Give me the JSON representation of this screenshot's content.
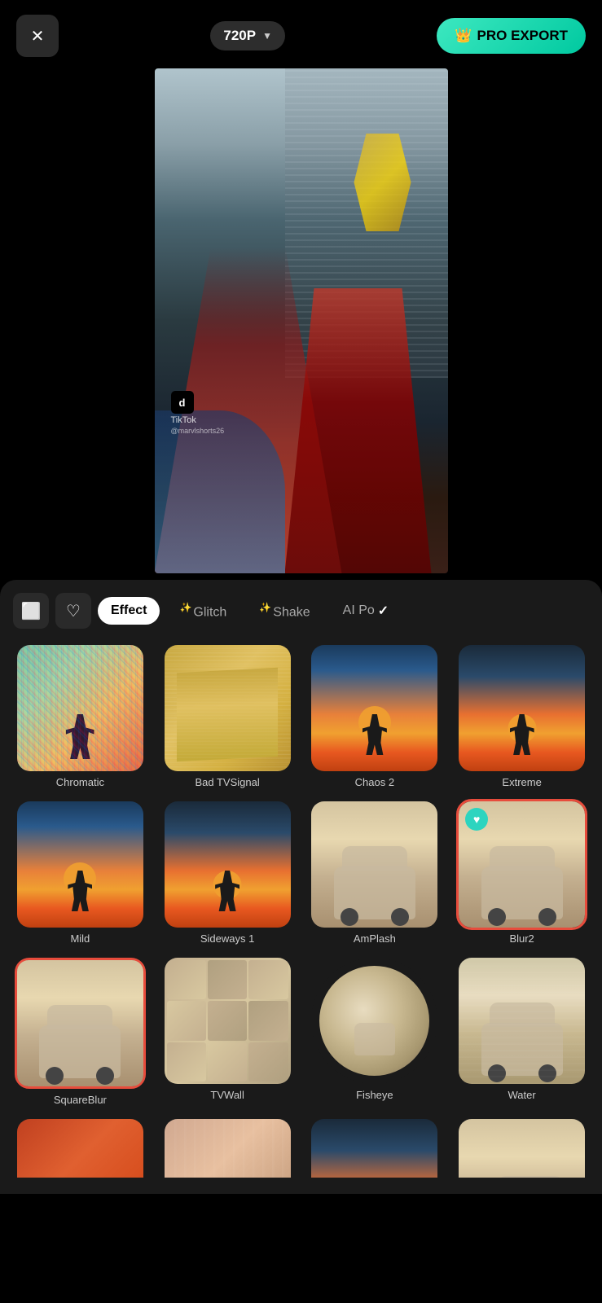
{
  "header": {
    "close_label": "✕",
    "quality": "720P",
    "quality_arrow": "▼",
    "pro_export_icon": "👑",
    "pro_export_label": "PRO EXPORT"
  },
  "video": {
    "watermark_logo": "d",
    "watermark_app": "TikTok",
    "watermark_user": "@marvlshorts26"
  },
  "tabs": [
    {
      "id": "archive",
      "icon": "🗂",
      "type": "icon"
    },
    {
      "id": "favorites",
      "icon": "♡",
      "type": "icon"
    },
    {
      "id": "effect",
      "label": "Effect",
      "active": true
    },
    {
      "id": "glitch",
      "label": "Glitch",
      "crown": "✨",
      "active": false
    },
    {
      "id": "shake",
      "label": "Shake",
      "crown": "✨",
      "active": false
    },
    {
      "id": "ai_po",
      "label": "AI Po",
      "active": false,
      "checkmark": true
    }
  ],
  "effects_row1": [
    {
      "id": "chromatic",
      "name": "Chromatic",
      "thumb_class": "thumb-chromatic",
      "selected": false
    },
    {
      "id": "badtvsignal",
      "name": "Bad TVSignal",
      "thumb_class": "thumb-badtv",
      "selected": false
    },
    {
      "id": "chaos2",
      "name": "Chaos 2",
      "thumb_class": "thumb-sunset",
      "selected": false
    },
    {
      "id": "extreme",
      "name": "Extreme",
      "thumb_class": "thumb-sunset-alt",
      "selected": false
    }
  ],
  "effects_row2": [
    {
      "id": "mild",
      "name": "Mild",
      "thumb_class": "thumb-sunset",
      "selected": false
    },
    {
      "id": "sideways1",
      "name": "Sideways 1",
      "thumb_class": "thumb-sunset-alt",
      "selected": false
    },
    {
      "id": "amplash",
      "name": "AmPlash",
      "thumb_class": "thumb-van",
      "selected": false
    },
    {
      "id": "blur2",
      "name": "Blur2",
      "thumb_class": "thumb-van",
      "selected": true,
      "heart": true
    }
  ],
  "effects_row3": [
    {
      "id": "squareblur",
      "name": "SquareBlur",
      "thumb_class": "thumb-van",
      "selected": true,
      "selected_color": "red"
    },
    {
      "id": "tvwall",
      "name": "TVWall",
      "thumb_class": "thumb-van-grid",
      "selected": false
    },
    {
      "id": "fisheye",
      "name": "Fisheye",
      "thumb_class": "thumb-fisheye",
      "selected": false
    },
    {
      "id": "water",
      "name": "Water",
      "thumb_class": "thumb-water",
      "selected": false
    }
  ],
  "effects_partial": [
    {
      "id": "partial1",
      "name": "",
      "thumb_class": "thumb-orange-van"
    },
    {
      "id": "partial2",
      "name": "",
      "thumb_class": "thumb-motion"
    },
    {
      "id": "partial3",
      "name": "",
      "thumb_class": "thumb-sunset-alt"
    },
    {
      "id": "partial4",
      "name": "",
      "thumb_class": "thumb-van"
    }
  ]
}
